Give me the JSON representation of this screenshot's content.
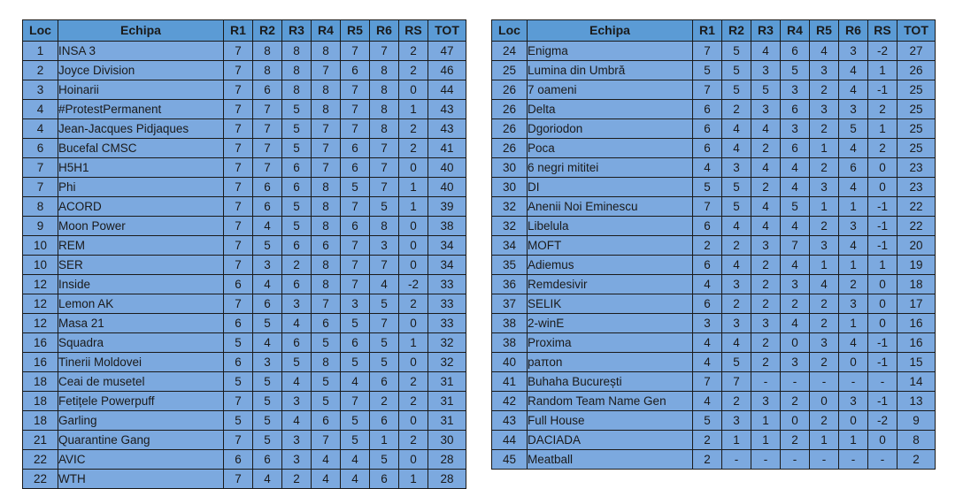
{
  "colors": {
    "header_bg": "#5B9BD5",
    "cell_bg": "#7CA9DF",
    "border": "#1a1a1a",
    "text": "#1a1a1a",
    "page_bg": "#FFFFFF"
  },
  "columns": {
    "loc": "Loc",
    "team": "Echipa",
    "r1": "R1",
    "r2": "R2",
    "r3": "R3",
    "r4": "R4",
    "r5": "R5",
    "r6": "R6",
    "rs": "RS",
    "tot": "TOT"
  },
  "chart_data": {
    "type": "table",
    "title": "",
    "headers": [
      "Loc",
      "Echipa",
      "R1",
      "R2",
      "R3",
      "R4",
      "R5",
      "R6",
      "RS",
      "TOT"
    ],
    "tables": [
      {
        "name": "left-standings-table",
        "rows": [
          [
            "1",
            "INSA 3",
            "7",
            "8",
            "8",
            "8",
            "7",
            "7",
            "2",
            "47"
          ],
          [
            "2",
            "Joyce Division",
            "7",
            "8",
            "8",
            "7",
            "6",
            "8",
            "2",
            "46"
          ],
          [
            "3",
            "Hoinarii",
            "7",
            "6",
            "8",
            "8",
            "7",
            "8",
            "0",
            "44"
          ],
          [
            "4",
            "#ProtestPermanent",
            "7",
            "7",
            "5",
            "8",
            "7",
            "8",
            "1",
            "43"
          ],
          [
            "4",
            "Jean-Jacques Pidjaques",
            "7",
            "7",
            "5",
            "7",
            "7",
            "8",
            "2",
            "43"
          ],
          [
            "6",
            "Bucefal CMSC",
            "7",
            "7",
            "5",
            "7",
            "6",
            "7",
            "2",
            "41"
          ],
          [
            "7",
            "H5H1",
            "7",
            "7",
            "6",
            "7",
            "6",
            "7",
            "0",
            "40"
          ],
          [
            "7",
            "Phi",
            "7",
            "6",
            "6",
            "8",
            "5",
            "7",
            "1",
            "40"
          ],
          [
            "8",
            "ACORD",
            "7",
            "6",
            "5",
            "8",
            "7",
            "5",
            "1",
            "39"
          ],
          [
            "9",
            "Moon Power",
            "7",
            "4",
            "5",
            "8",
            "6",
            "8",
            "0",
            "38"
          ],
          [
            "10",
            "REM",
            "7",
            "5",
            "6",
            "6",
            "7",
            "3",
            "0",
            "34"
          ],
          [
            "10",
            "SER",
            "7",
            "3",
            "2",
            "8",
            "7",
            "7",
            "0",
            "34"
          ],
          [
            "12",
            "Inside",
            "6",
            "4",
            "6",
            "8",
            "7",
            "4",
            "-2",
            "33"
          ],
          [
            "12",
            "Lemon AK",
            "7",
            "6",
            "3",
            "7",
            "3",
            "5",
            "2",
            "33"
          ],
          [
            "12",
            "Masa 21",
            "6",
            "5",
            "4",
            "6",
            "5",
            "7",
            "0",
            "33"
          ],
          [
            "16",
            "Squadra",
            "5",
            "4",
            "6",
            "5",
            "6",
            "5",
            "1",
            "32"
          ],
          [
            "16",
            "Tinerii Moldovei",
            "6",
            "3",
            "5",
            "8",
            "5",
            "5",
            "0",
            "32"
          ],
          [
            "18",
            "Ceai de musetel",
            "5",
            "5",
            "4",
            "5",
            "4",
            "6",
            "2",
            "31"
          ],
          [
            "18",
            "Fetițele Powerpuff",
            "7",
            "5",
            "3",
            "5",
            "7",
            "2",
            "2",
            "31"
          ],
          [
            "18",
            "Garling",
            "5",
            "5",
            "4",
            "6",
            "5",
            "6",
            "0",
            "31"
          ],
          [
            "21",
            "Quarantine Gang",
            "7",
            "5",
            "3",
            "7",
            "5",
            "1",
            "2",
            "30"
          ],
          [
            "22",
            "AVIC",
            "6",
            "6",
            "3",
            "4",
            "4",
            "5",
            "0",
            "28"
          ],
          [
            "22",
            "WTH",
            "7",
            "4",
            "2",
            "4",
            "4",
            "6",
            "1",
            "28"
          ]
        ]
      },
      {
        "name": "right-standings-table",
        "rows": [
          [
            "24",
            "Enigma",
            "7",
            "5",
            "4",
            "6",
            "4",
            "3",
            "-2",
            "27"
          ],
          [
            "25",
            "Lumina din Umbră",
            "5",
            "5",
            "3",
            "5",
            "3",
            "4",
            "1",
            "26"
          ],
          [
            "26",
            "7 oameni",
            "7",
            "5",
            "5",
            "3",
            "2",
            "4",
            "-1",
            "25"
          ],
          [
            "26",
            "Delta",
            "6",
            "2",
            "3",
            "6",
            "3",
            "3",
            "2",
            "25"
          ],
          [
            "26",
            "Dgoriodon",
            "6",
            "4",
            "4",
            "3",
            "2",
            "5",
            "1",
            "25"
          ],
          [
            "26",
            "Poca",
            "6",
            "4",
            "2",
            "6",
            "1",
            "4",
            "2",
            "25"
          ],
          [
            "30",
            "6 negri mititei",
            "4",
            "3",
            "4",
            "4",
            "2",
            "6",
            "0",
            "23"
          ],
          [
            "30",
            "DI",
            "5",
            "5",
            "2",
            "4",
            "3",
            "4",
            "0",
            "23"
          ],
          [
            "32",
            "Anenii Noi Eminescu",
            "7",
            "5",
            "4",
            "5",
            "1",
            "1",
            "-1",
            "22"
          ],
          [
            "32",
            "Libelula",
            "6",
            "4",
            "4",
            "4",
            "2",
            "3",
            "-1",
            "22"
          ],
          [
            "34",
            "MOFT",
            "2",
            "2",
            "3",
            "7",
            "3",
            "4",
            "-1",
            "20"
          ],
          [
            "35",
            "Adiemus",
            "6",
            "4",
            "2",
            "4",
            "1",
            "1",
            "1",
            "19"
          ],
          [
            "36",
            "Remdesivir",
            "4",
            "3",
            "2",
            "3",
            "4",
            "2",
            "0",
            "18"
          ],
          [
            "37",
            "SELIK",
            "6",
            "2",
            "2",
            "2",
            "2",
            "3",
            "0",
            "17"
          ],
          [
            "38",
            "2-winE",
            "3",
            "3",
            "3",
            "4",
            "2",
            "1",
            "0",
            "16"
          ],
          [
            "38",
            "Proxima",
            "4",
            "4",
            "2",
            "0",
            "3",
            "4",
            "-1",
            "16"
          ],
          [
            "40",
            "paπon",
            "4",
            "5",
            "2",
            "3",
            "2",
            "0",
            "-1",
            "15"
          ],
          [
            "41",
            "Buhaha București",
            "7",
            "7",
            "-",
            "-",
            "-",
            "-",
            "-",
            "14"
          ],
          [
            "42",
            "Random Team Name Gen",
            "4",
            "2",
            "3",
            "2",
            "0",
            "3",
            "-1",
            "13"
          ],
          [
            "43",
            "Full House",
            "5",
            "3",
            "1",
            "0",
            "2",
            "0",
            "-2",
            "9"
          ],
          [
            "44",
            "DACIADA",
            "2",
            "1",
            "1",
            "2",
            "1",
            "1",
            "0",
            "8"
          ],
          [
            "45",
            "Meatball",
            "2",
            "-",
            "-",
            "-",
            "-",
            "-",
            "-",
            "2"
          ]
        ]
      }
    ]
  }
}
